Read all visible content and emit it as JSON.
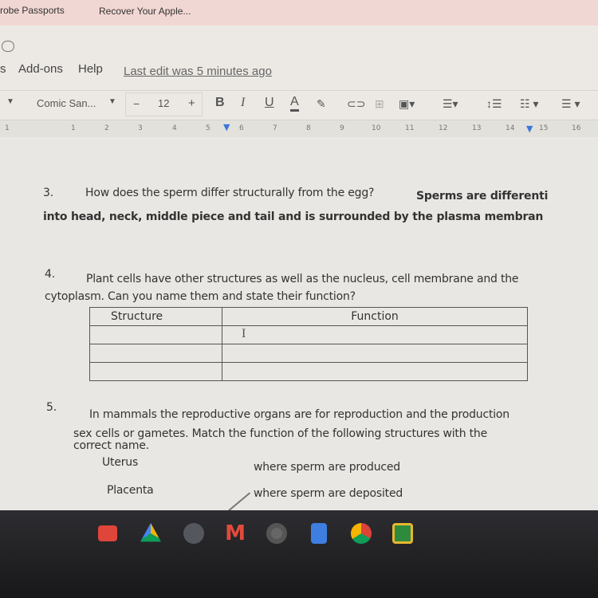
{
  "bookmarks": {
    "items": [
      "robe Passports",
      "Recover Your Apple..."
    ]
  },
  "menu": {
    "items": [
      "s",
      "Add-ons",
      "Help"
    ],
    "last_edit": "Last edit was 5 minutes ago"
  },
  "toolbar": {
    "font": "Comic San...",
    "font_size": "12",
    "minus": "−",
    "plus": "+",
    "bold": "B",
    "italic": "I",
    "underline": "U",
    "text_color": "A"
  },
  "ruler": {
    "ticks": [
      "1",
      "1",
      "2",
      "3",
      "4",
      "5",
      "6",
      "7",
      "8",
      "9",
      "10",
      "11",
      "12",
      "13",
      "14",
      "15",
      "16"
    ]
  },
  "document": {
    "q3": {
      "number": "3.",
      "question": "How does the sperm differ structurally from the egg?",
      "answer_part1": "Sperms are differenti",
      "answer_part2": "into head, neck, middle piece and tail and is surrounded by the plasma membran"
    },
    "q4": {
      "number": "4.",
      "line1": "Plant cells have other structures as well as the nucleus, cell membrane and the",
      "line2": "cytoplasm. Can you name them and state their function?",
      "table": {
        "headers": [
          "Structure",
          "Function"
        ],
        "rows": [
          [
            "",
            ""
          ],
          [
            "",
            ""
          ],
          [
            "",
            ""
          ]
        ]
      }
    },
    "q5": {
      "number": "5.",
      "line1": "In mammals the reproductive organs are for reproduction and the production",
      "line2": "sex cells or gametes. Match the function of the following structures with the",
      "line3": "correct name.",
      "left": [
        "Uterus",
        "Placenta"
      ],
      "right": [
        "where sperm are produced",
        "where sperm are deposited"
      ]
    }
  },
  "taskbar": {
    "apps": [
      "youtube-icon",
      "drive-icon",
      "photos-icon",
      "gmail-icon",
      "camera-icon",
      "docs-icon",
      "chrome-icon",
      "classroom-icon"
    ]
  }
}
